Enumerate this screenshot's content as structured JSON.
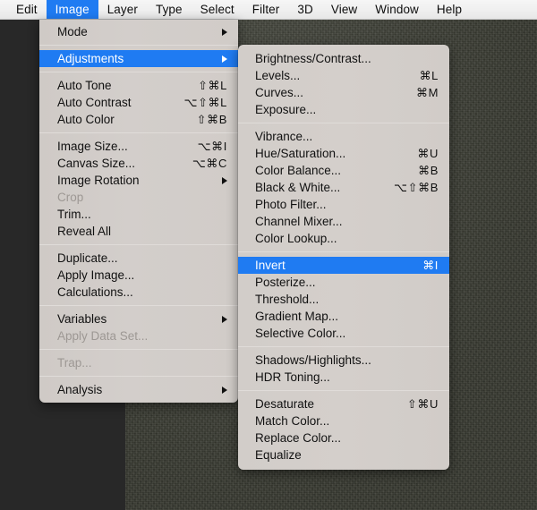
{
  "menubar": {
    "items": [
      {
        "label": "Edit",
        "active": false
      },
      {
        "label": "Image",
        "active": true
      },
      {
        "label": "Layer",
        "active": false
      },
      {
        "label": "Type",
        "active": false
      },
      {
        "label": "Select",
        "active": false
      },
      {
        "label": "Filter",
        "active": false
      },
      {
        "label": "3D",
        "active": false
      },
      {
        "label": "View",
        "active": false
      },
      {
        "label": "Window",
        "active": false
      },
      {
        "label": "Help",
        "active": false
      }
    ]
  },
  "colors": {
    "highlight": "#1f7bf2",
    "menu_background": "#d2cdc9",
    "menubar_background": "#efefef",
    "disabled_text": "#9d9894",
    "canvas": "#3e4036",
    "workspace": "#282828"
  },
  "image_menu": {
    "groups": [
      {
        "rows": [
          {
            "label": "Mode",
            "shortcut": "",
            "submenu": true,
            "disabled": false,
            "selected": false
          }
        ]
      },
      {
        "rows": [
          {
            "label": "Adjustments",
            "shortcut": "",
            "submenu": true,
            "disabled": false,
            "selected": true
          }
        ]
      },
      {
        "rows": [
          {
            "label": "Auto Tone",
            "shortcut": "⇧⌘L",
            "submenu": false,
            "disabled": false,
            "selected": false
          },
          {
            "label": "Auto Contrast",
            "shortcut": "⌥⇧⌘L",
            "submenu": false,
            "disabled": false,
            "selected": false
          },
          {
            "label": "Auto Color",
            "shortcut": "⇧⌘B",
            "submenu": false,
            "disabled": false,
            "selected": false
          }
        ]
      },
      {
        "rows": [
          {
            "label": "Image Size...",
            "shortcut": "⌥⌘I",
            "submenu": false,
            "disabled": false,
            "selected": false
          },
          {
            "label": "Canvas Size...",
            "shortcut": "⌥⌘C",
            "submenu": false,
            "disabled": false,
            "selected": false
          },
          {
            "label": "Image Rotation",
            "shortcut": "",
            "submenu": true,
            "disabled": false,
            "selected": false
          },
          {
            "label": "Crop",
            "shortcut": "",
            "submenu": false,
            "disabled": true,
            "selected": false
          },
          {
            "label": "Trim...",
            "shortcut": "",
            "submenu": false,
            "disabled": false,
            "selected": false
          },
          {
            "label": "Reveal All",
            "shortcut": "",
            "submenu": false,
            "disabled": false,
            "selected": false
          }
        ]
      },
      {
        "rows": [
          {
            "label": "Duplicate...",
            "shortcut": "",
            "submenu": false,
            "disabled": false,
            "selected": false
          },
          {
            "label": "Apply Image...",
            "shortcut": "",
            "submenu": false,
            "disabled": false,
            "selected": false
          },
          {
            "label": "Calculations...",
            "shortcut": "",
            "submenu": false,
            "disabled": false,
            "selected": false
          }
        ]
      },
      {
        "rows": [
          {
            "label": "Variables",
            "shortcut": "",
            "submenu": true,
            "disabled": false,
            "selected": false
          },
          {
            "label": "Apply Data Set...",
            "shortcut": "",
            "submenu": false,
            "disabled": true,
            "selected": false
          }
        ]
      },
      {
        "rows": [
          {
            "label": "Trap...",
            "shortcut": "",
            "submenu": false,
            "disabled": true,
            "selected": false
          }
        ]
      },
      {
        "rows": [
          {
            "label": "Analysis",
            "shortcut": "",
            "submenu": true,
            "disabled": false,
            "selected": false
          }
        ]
      }
    ]
  },
  "adjustments_submenu": {
    "groups": [
      {
        "rows": [
          {
            "label": "Brightness/Contrast...",
            "shortcut": "",
            "submenu": false,
            "disabled": false,
            "selected": false
          },
          {
            "label": "Levels...",
            "shortcut": "⌘L",
            "submenu": false,
            "disabled": false,
            "selected": false
          },
          {
            "label": "Curves...",
            "shortcut": "⌘M",
            "submenu": false,
            "disabled": false,
            "selected": false
          },
          {
            "label": "Exposure...",
            "shortcut": "",
            "submenu": false,
            "disabled": false,
            "selected": false
          }
        ]
      },
      {
        "rows": [
          {
            "label": "Vibrance...",
            "shortcut": "",
            "submenu": false,
            "disabled": false,
            "selected": false
          },
          {
            "label": "Hue/Saturation...",
            "shortcut": "⌘U",
            "submenu": false,
            "disabled": false,
            "selected": false
          },
          {
            "label": "Color Balance...",
            "shortcut": "⌘B",
            "submenu": false,
            "disabled": false,
            "selected": false
          },
          {
            "label": "Black & White...",
            "shortcut": "⌥⇧⌘B",
            "submenu": false,
            "disabled": false,
            "selected": false
          },
          {
            "label": "Photo Filter...",
            "shortcut": "",
            "submenu": false,
            "disabled": false,
            "selected": false
          },
          {
            "label": "Channel Mixer...",
            "shortcut": "",
            "submenu": false,
            "disabled": false,
            "selected": false
          },
          {
            "label": "Color Lookup...",
            "shortcut": "",
            "submenu": false,
            "disabled": false,
            "selected": false
          }
        ]
      },
      {
        "rows": [
          {
            "label": "Invert",
            "shortcut": "⌘I",
            "submenu": false,
            "disabled": false,
            "selected": true
          },
          {
            "label": "Posterize...",
            "shortcut": "",
            "submenu": false,
            "disabled": false,
            "selected": false
          },
          {
            "label": "Threshold...",
            "shortcut": "",
            "submenu": false,
            "disabled": false,
            "selected": false
          },
          {
            "label": "Gradient Map...",
            "shortcut": "",
            "submenu": false,
            "disabled": false,
            "selected": false
          },
          {
            "label": "Selective Color...",
            "shortcut": "",
            "submenu": false,
            "disabled": false,
            "selected": false
          }
        ]
      },
      {
        "rows": [
          {
            "label": "Shadows/Highlights...",
            "shortcut": "",
            "submenu": false,
            "disabled": false,
            "selected": false
          },
          {
            "label": "HDR Toning...",
            "shortcut": "",
            "submenu": false,
            "disabled": false,
            "selected": false
          }
        ]
      },
      {
        "rows": [
          {
            "label": "Desaturate",
            "shortcut": "⇧⌘U",
            "submenu": false,
            "disabled": false,
            "selected": false
          },
          {
            "label": "Match Color...",
            "shortcut": "",
            "submenu": false,
            "disabled": false,
            "selected": false
          },
          {
            "label": "Replace Color...",
            "shortcut": "",
            "submenu": false,
            "disabled": false,
            "selected": false
          },
          {
            "label": "Equalize",
            "shortcut": "",
            "submenu": false,
            "disabled": false,
            "selected": false
          }
        ]
      }
    ]
  }
}
